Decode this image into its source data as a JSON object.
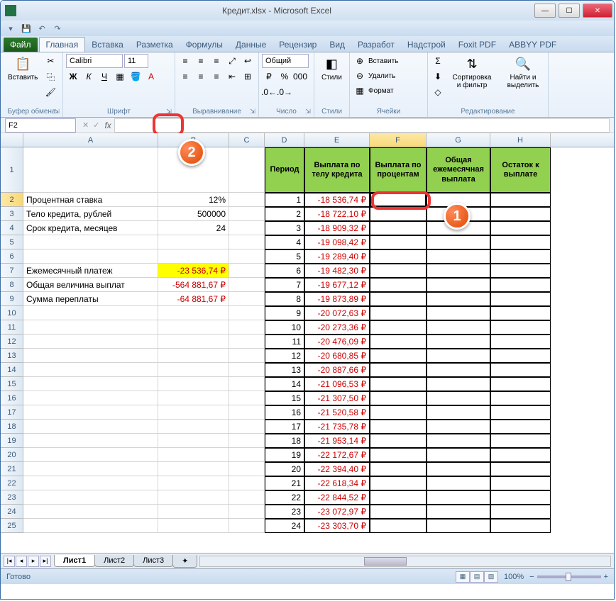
{
  "window": {
    "title": "Кредит.xlsx - Microsoft Excel",
    "min": "—",
    "max": "☐",
    "close": "✕"
  },
  "qat": {
    "save": "💾",
    "undo": "↶",
    "redo": "↷"
  },
  "tabs": {
    "file": "Файл",
    "home": "Главная",
    "insert": "Вставка",
    "layout": "Разметка",
    "formulas": "Формулы",
    "data": "Данные",
    "review": "Рецензир",
    "view": "Вид",
    "developer": "Разработ",
    "addins": "Надстрой",
    "foxit": "Foxit PDF",
    "abbyy": "ABBYY PDF"
  },
  "ribbon": {
    "paste": "Вставить",
    "clipboard": "Буфер обмена",
    "font_name": "Calibri",
    "font_size": "11",
    "font": "Шрифт",
    "alignment": "Выравнивание",
    "number_fmt": "Общий",
    "number": "Число",
    "styles": "Стили",
    "styles_btn": "Стили",
    "insert_btn": "Вставить",
    "delete_btn": "Удалить",
    "format_btn": "Формат",
    "cells": "Ячейки",
    "sort": "Сортировка и фильтр",
    "find": "Найти и выделить",
    "editing": "Редактирование"
  },
  "namebox": {
    "ref": "F2",
    "fx": "fx"
  },
  "columns": [
    "A",
    "B",
    "C",
    "D",
    "E",
    "F",
    "G",
    "H"
  ],
  "headers": {
    "D": "Период",
    "E": "Выплата по телу кредита",
    "F": "Выплата по процентам",
    "G": "Общая ежемесячная выплата",
    "H": "Остаток к выплате"
  },
  "labels": {
    "rate": "Процентная ставка",
    "rate_val": "12%",
    "body": "Тело кредита, рублей",
    "body_val": "500000",
    "term": "Срок кредита, месяцев",
    "term_val": "24",
    "monthly": "Ежемесячный платеж",
    "monthly_val": "-23 536,74 ₽",
    "total": "Общая величина выплат",
    "total_val": "-564 881,67 ₽",
    "overpay": "Сумма переплаты",
    "overpay_val": "-64 881,67 ₽"
  },
  "periods": [
    1,
    2,
    3,
    4,
    5,
    6,
    7,
    8,
    9,
    10,
    11,
    12,
    13,
    14,
    15,
    16,
    17,
    18,
    19,
    20,
    21,
    22,
    23,
    24
  ],
  "payments": [
    "-18 536,74 ₽",
    "-18 722,10 ₽",
    "-18 909,32 ₽",
    "-19 098,42 ₽",
    "-19 289,40 ₽",
    "-19 482,30 ₽",
    "-19 677,12 ₽",
    "-19 873,89 ₽",
    "-20 072,63 ₽",
    "-20 273,36 ₽",
    "-20 476,09 ₽",
    "-20 680,85 ₽",
    "-20 887,66 ₽",
    "-21 096,53 ₽",
    "-21 307,50 ₽",
    "-21 520,58 ₽",
    "-21 735,78 ₽",
    "-21 953,14 ₽",
    "-22 172,67 ₽",
    "-22 394,40 ₽",
    "-22 618,34 ₽",
    "-22 844,52 ₽",
    "-23 072,97 ₽",
    "-23 303,70 ₽"
  ],
  "markers": {
    "m1": "1",
    "m2": "2"
  },
  "sheets": {
    "s1": "Лист1",
    "s2": "Лист2",
    "s3": "Лист3"
  },
  "status": {
    "ready": "Готово",
    "zoom": "100%"
  }
}
